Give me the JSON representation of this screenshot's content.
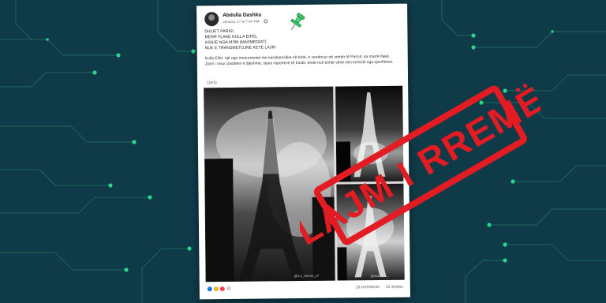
{
  "post": {
    "author": "Abdulla Dashku",
    "date": "January 17 at 7:04 PM",
    "dot": "·",
    "headline_lines": [
      "DIGJET PARISI",
      "MERR FLAKE KULLA EIFEL",
      "ASNJE NGA MSM (MASMEDIAT)",
      "NUK E TRANSMETOJNE KETE LAJM"
    ],
    "body_text_1": "Kulla Eifel, një nga monumentet me karakteristike në botë, e vendosur në zemër të Parisit, ka marrë flakë.",
    "body_text_2": "Zjarri i nisur pasditen e djeshme, sipas raporteve të fundit, ende nuk është vënë nën kontroll nga zjarrfikësit.",
    "reaction_line": "11e11",
    "reaction_count": "32",
    "comments": "10 comments",
    "shares": "12 shares",
    "image_caption_main": "@3.2_reinas_17",
    "image_caption_br": "@AxLadiv..."
  },
  "stamp": {
    "text": "LAJM I RREMË",
    "color": "#e31b23"
  },
  "theme": {
    "background": "#0f3a47",
    "circuit": "#2bd48a"
  },
  "icons": [
    "globe-icon",
    "pushpin-icon",
    "reaction-icons"
  ]
}
